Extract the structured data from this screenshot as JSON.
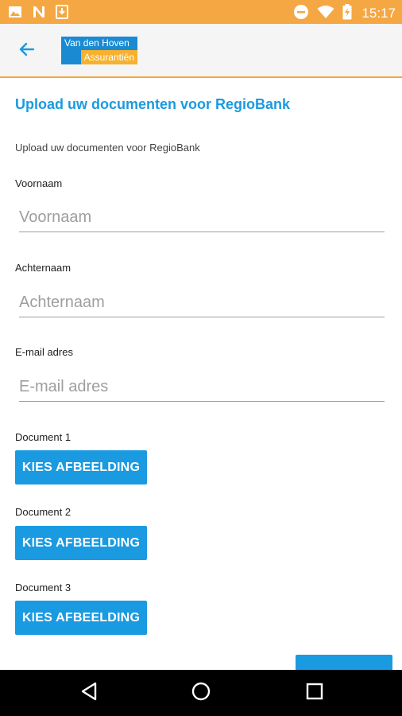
{
  "status_bar": {
    "time": "15:17"
  },
  "app_bar": {
    "logo_line1": "Van den Hoven",
    "logo_line2": "Assurantiën"
  },
  "page": {
    "title": "Upload uw documenten voor RegioBank",
    "intro": "Upload uw documenten voor RegioBank"
  },
  "form": {
    "firstname": {
      "label": "Voornaam",
      "placeholder": "Voornaam"
    },
    "lastname": {
      "label": "Achternaam",
      "placeholder": "Achternaam"
    },
    "email": {
      "label": "E-mail adres",
      "placeholder": "E-mail adres"
    },
    "documents": [
      {
        "label": "Document 1",
        "button": "KIES AFBEELDING"
      },
      {
        "label": "Document 2",
        "button": "KIES AFBEELDING"
      },
      {
        "label": "Document 3",
        "button": "KIES AFBEELDING"
      }
    ]
  },
  "colors": {
    "status_bar": "#f4a742",
    "accent": "#1a9ae0",
    "logo_blue": "#1a8ad2",
    "logo_orange": "#f7b12f"
  },
  "icons": [
    "image-icon",
    "n-icon",
    "download-icon",
    "do-not-disturb-icon",
    "wifi-icon",
    "battery-charging-icon",
    "back-arrow-icon",
    "nav-back-icon",
    "nav-home-icon",
    "nav-recents-icon"
  ]
}
